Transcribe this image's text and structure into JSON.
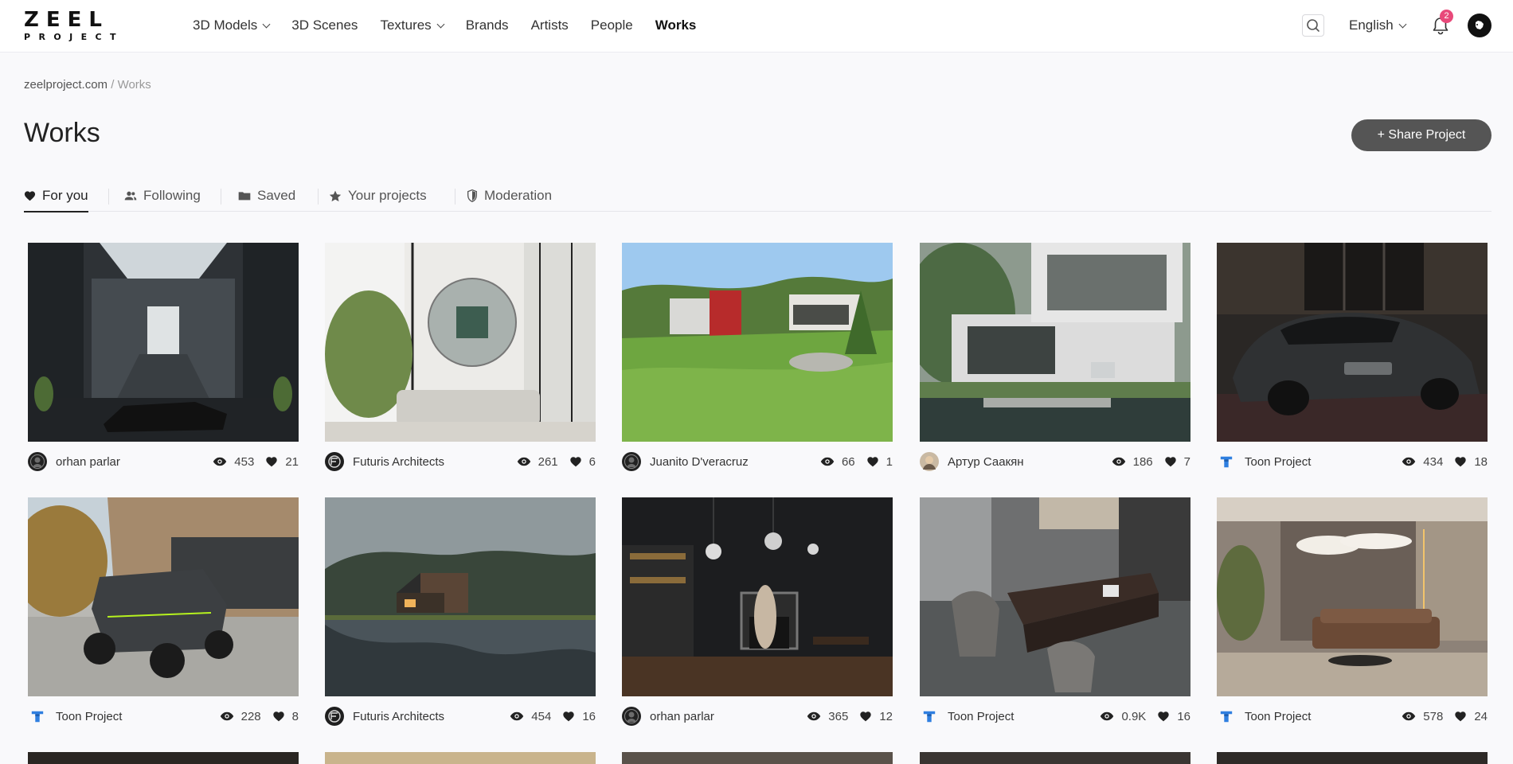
{
  "logo": {
    "top": "ZEEL",
    "bottom": "PROJECT"
  },
  "nav": [
    {
      "label": "3D Models",
      "dropdown": true
    },
    {
      "label": "3D Scenes",
      "dropdown": false
    },
    {
      "label": "Textures",
      "dropdown": true
    },
    {
      "label": "Brands",
      "dropdown": false
    },
    {
      "label": "Artists",
      "dropdown": false
    },
    {
      "label": "People",
      "dropdown": false
    },
    {
      "label": "Works",
      "dropdown": false,
      "active": true
    }
  ],
  "header": {
    "language": "English",
    "notification_count": "2"
  },
  "breadcrumb": {
    "home": "zeelproject.com",
    "separator": " / ",
    "current": "Works"
  },
  "page_title": "Works",
  "share_button": "+ Share Project",
  "tabs": [
    {
      "label": "For you",
      "icon": "heart-icon",
      "active": true
    },
    {
      "label": "Following",
      "icon": "users-icon"
    },
    {
      "label": "Saved",
      "icon": "folder-icon"
    },
    {
      "label": "Your projects",
      "icon": "star-icon"
    },
    {
      "label": "Moderation",
      "icon": "shield-icon"
    }
  ],
  "works": [
    {
      "author": "orhan parlar",
      "views": "453",
      "likes": "21",
      "avatar": "photo-dark",
      "scene": "batmobile-hall"
    },
    {
      "author": "Futuris Architects",
      "views": "261",
      "likes": "6",
      "avatar": "futuris-logo",
      "scene": "mirror-lounge"
    },
    {
      "author": "Juanito D'veracruz",
      "views": "66",
      "likes": "1",
      "avatar": "photo-dark",
      "scene": "hillside-house"
    },
    {
      "author": "Артур Саакян",
      "views": "186",
      "likes": "7",
      "avatar": "photo-face",
      "scene": "modern-villa"
    },
    {
      "author": "Toon Project",
      "views": "434",
      "likes": "18",
      "avatar": "toon-logo",
      "scene": "classic-car"
    },
    {
      "author": "Toon Project",
      "views": "228",
      "likes": "8",
      "avatar": "toon-logo",
      "scene": "robot-vehicle"
    },
    {
      "author": "Futuris Architects",
      "views": "454",
      "likes": "16",
      "avatar": "futuris-logo",
      "scene": "lake-house"
    },
    {
      "author": "orhan parlar",
      "views": "365",
      "likes": "12",
      "avatar": "photo-dark",
      "scene": "dark-interior"
    },
    {
      "author": "Toon Project",
      "views": "0.9K",
      "likes": "16",
      "avatar": "toon-logo",
      "scene": "office-desk"
    },
    {
      "author": "Toon Project",
      "views": "578",
      "likes": "24",
      "avatar": "toon-logo",
      "scene": "living-room"
    }
  ],
  "colors": {
    "accent": "#555555",
    "badge": "#e8497a",
    "toon_blue": "#2f7fe0"
  }
}
